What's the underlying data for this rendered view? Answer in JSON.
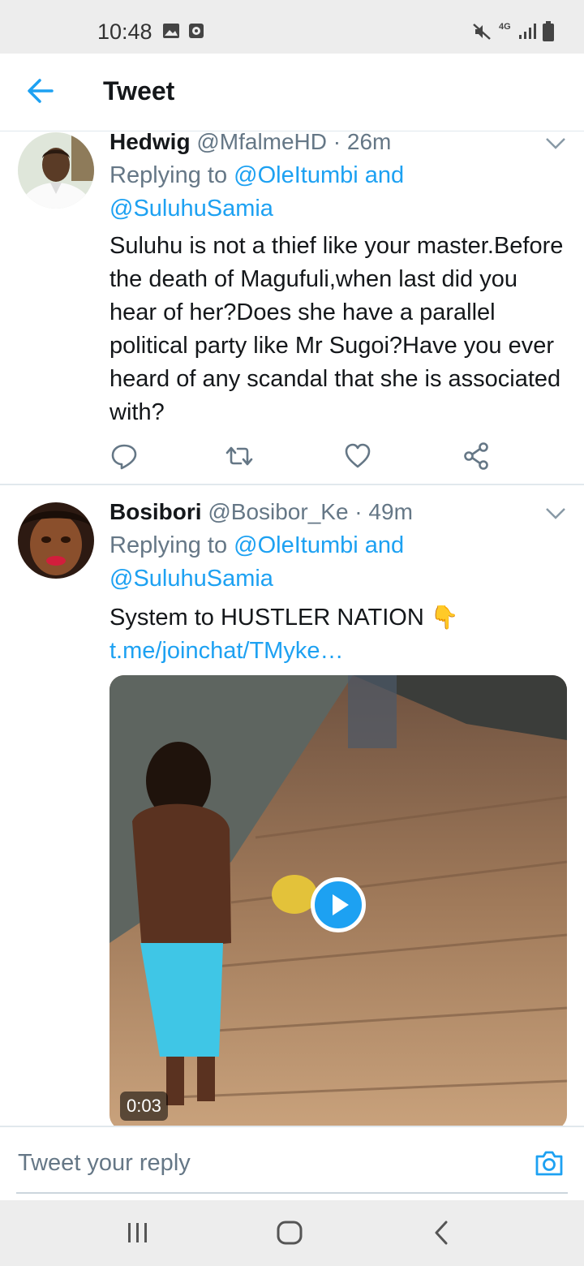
{
  "status_bar": {
    "time": "10:48",
    "network": "4G"
  },
  "header": {
    "title": "Tweet"
  },
  "tweets": [
    {
      "name": "Hedwig",
      "handle": "@MfalmeHD",
      "time": "26m",
      "replying_prefix": "Replying to",
      "mention_1": "@OleItumbi",
      "and": "and",
      "mention_2": "@SuluhuSamia",
      "text": "Suluhu is not a thief like your master.Before the death of Magufuli,when last did you hear of her?Does she have a parallel political party like Mr Sugoi?Have you ever heard of any scandal that she is associated with?"
    },
    {
      "name": "Bosibori",
      "handle": "@Bosibor_Ke",
      "time": "49m",
      "replying_prefix": "Replying to",
      "mention_1": "@OleItumbi",
      "and": "and",
      "mention_2": "@SuluhuSamia",
      "text": "System to HUSTLER NATION",
      "emoji": "👇",
      "link": "t.me/joinchat/TMyke…",
      "media_duration": "0:03"
    }
  ],
  "reply_bar": {
    "placeholder": "Tweet your reply"
  },
  "colors": {
    "accent": "#1da1f2",
    "secondary_text": "#657786",
    "primary_text": "#14171a"
  }
}
